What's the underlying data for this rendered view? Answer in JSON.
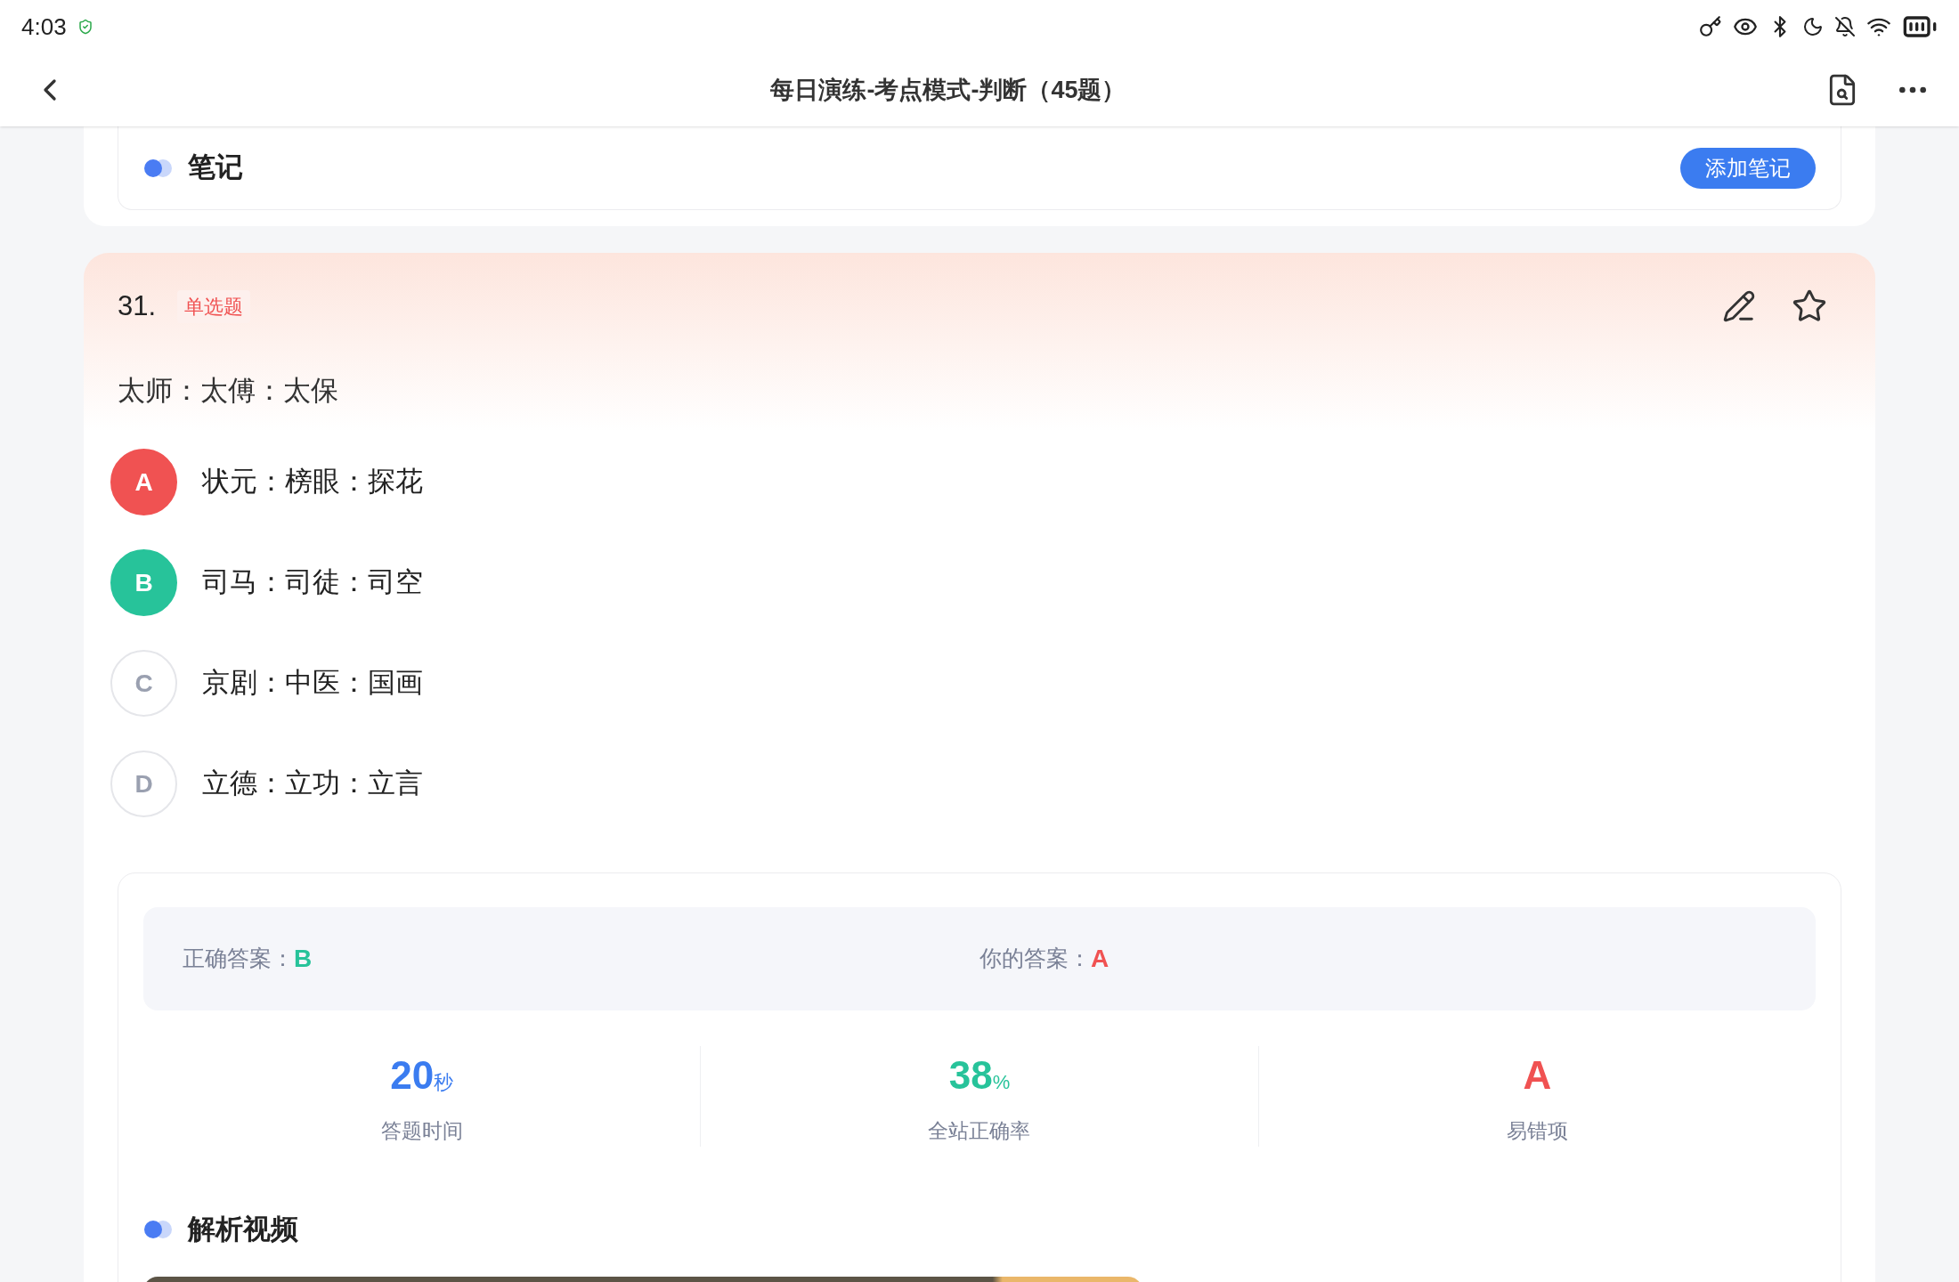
{
  "status_bar": {
    "time": "4:03"
  },
  "header": {
    "title": "每日演练-考点模式-判断（45题）"
  },
  "note": {
    "title": "笔记",
    "button": "添加笔记"
  },
  "question": {
    "number": "31.",
    "type_tag": "单选题",
    "stem": "太师：太傅：太保",
    "options": [
      {
        "letter": "A",
        "text": "状元：榜眼：探花",
        "selected": true,
        "correct": false
      },
      {
        "letter": "B",
        "text": "司马：司徒：司空",
        "selected": false,
        "correct": true
      },
      {
        "letter": "C",
        "text": "京剧：中医：国画",
        "selected": false,
        "correct": false
      },
      {
        "letter": "D",
        "text": "立德：立功：立言",
        "selected": false,
        "correct": false
      }
    ]
  },
  "result": {
    "correct_label": "正确答案：",
    "correct_value": "B",
    "yours_label": "你的答案：",
    "yours_value": "A",
    "stats": [
      {
        "value": "20",
        "unit": "秒",
        "label": "答题时间",
        "color": "#3b7cf0"
      },
      {
        "value": "38",
        "unit": "%",
        "label": "全站正确率",
        "color": "#27c39a"
      },
      {
        "value": "A",
        "label": "易错项",
        "color": "#f05252"
      }
    ]
  },
  "video": {
    "title": "解析视频"
  }
}
